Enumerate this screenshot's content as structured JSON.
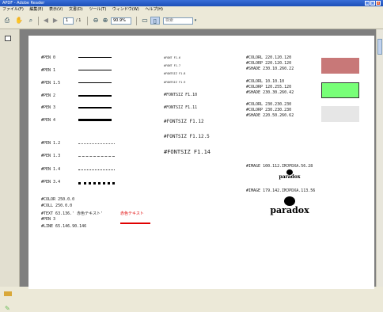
{
  "window": {
    "title": "APDF - Adobe Reader"
  },
  "menu": [
    "ファイル(F)",
    "編集(E)",
    "表示(V)",
    "文書(D)",
    "ツール(T)",
    "ウィンドウ(W)",
    "ヘルプ(H)"
  ],
  "toolbar": {
    "page_current": "1",
    "page_total": "/ 1",
    "zoom": "90.9%",
    "search_placeholder": "検索"
  },
  "pens": [
    {
      "label": "#PEN 0"
    },
    {
      "label": "#PEN 1"
    },
    {
      "label": "#PEN 1.5"
    },
    {
      "label": "#PEN 2"
    },
    {
      "label": "#PEN 3"
    },
    {
      "label": "#PEN 4"
    },
    {
      "label": "#PEN 1.2"
    },
    {
      "label": "#PEN 1.3"
    },
    {
      "label": "#PEN 1.4"
    },
    {
      "label": "#PEN 3.4"
    }
  ],
  "fonts": {
    "tiny": [
      "#FONT F1.6",
      "#FONT F1.7",
      "#FONTSIZ F1.8",
      "#FONTSIZ F1.9"
    ],
    "mid": [
      "#FONTSIZ F1.10",
      "#FONTSIZ F1.11"
    ],
    "large": [
      "#FONTSIZ F1.12",
      "#FONTSIZ F1.12.5"
    ],
    "xl": "#FONTSIZ F1.14"
  },
  "colors": [
    {
      "lines": [
        "#COLORL   220.120.120",
        "#COLORP   220.120.120",
        "#SHADE   230.10.260.22"
      ],
      "fill": "#c87878"
    },
    {
      "lines": [
        "#COLORL   10.10.10",
        "#COLORP   120.255.120",
        "#SHADE   230.30.260.42"
      ],
      "fill": "#78ff78"
    },
    {
      "lines": [
        "#COLORL   230.230.230",
        "#COLORP   230.230.230",
        "#SHADE   220.50.260.62"
      ],
      "fill": "#e6e6e6"
    }
  ],
  "images": [
    {
      "label": "#IMAGE 100.112.IMJPDXA.56.28",
      "logo": "paradox"
    },
    {
      "label": "#IMAGE 179.142.IMJPDXA.113.56",
      "logo": "paradox"
    }
  ],
  "bottom_block": {
    "color": "#COLOR 250.0.0",
    "color2": "#COLL 250.0.0",
    "text_label": "#TEXT 63.136.'",
    "text_black": "赤色テキスト",
    "text_quote": "'",
    "text_red": "赤色テキスト",
    "pen": "#PEN 3",
    "line": "#LINE 65.146.90.146"
  }
}
